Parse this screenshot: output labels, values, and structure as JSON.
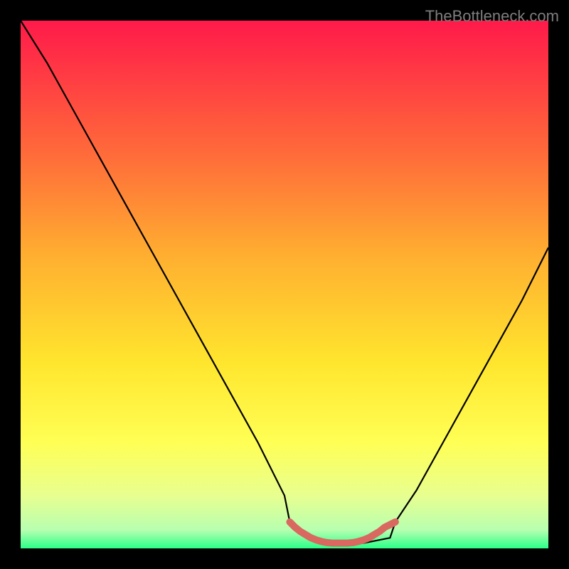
{
  "watermark": "TheBottleneck.com",
  "chart_data": {
    "type": "line",
    "title": "",
    "xlabel": "",
    "ylabel": "",
    "xlim": [
      0,
      100
    ],
    "ylim": [
      0,
      100
    ],
    "gradient_stops": [
      {
        "offset": 0,
        "color": "#ff1a4a"
      },
      {
        "offset": 0.25,
        "color": "#ff6a3a"
      },
      {
        "offset": 0.45,
        "color": "#ffb030"
      },
      {
        "offset": 0.65,
        "color": "#ffe62e"
      },
      {
        "offset": 0.8,
        "color": "#ffff55"
      },
      {
        "offset": 0.9,
        "color": "#e8ff90"
      },
      {
        "offset": 0.965,
        "color": "#b8ffb0"
      },
      {
        "offset": 1.0,
        "color": "#2aff88"
      }
    ],
    "curve": {
      "description": "black bottleneck curve",
      "x": [
        0,
        5,
        10,
        15,
        20,
        25,
        30,
        35,
        40,
        45,
        50,
        51,
        55,
        60,
        65,
        70,
        71,
        75,
        80,
        85,
        90,
        95,
        100
      ],
      "y": [
        100,
        92,
        83,
        74,
        65,
        56,
        47,
        38,
        29,
        20,
        10,
        5,
        2,
        1,
        1,
        2,
        5,
        11,
        20,
        29,
        38,
        47,
        57
      ]
    },
    "highlight_segment": {
      "color": "#d96860",
      "x": [
        51,
        52,
        53,
        54,
        55,
        56,
        57,
        58,
        59,
        60,
        61,
        62,
        63,
        64,
        65,
        66,
        67,
        68,
        69,
        70,
        71
      ],
      "y": [
        5,
        4,
        3.2,
        2.6,
        2,
        1.6,
        1.3,
        1.1,
        1,
        1,
        1,
        1,
        1.1,
        1.3,
        1.6,
        2,
        2.6,
        3.2,
        4,
        4.5,
        5
      ]
    }
  }
}
